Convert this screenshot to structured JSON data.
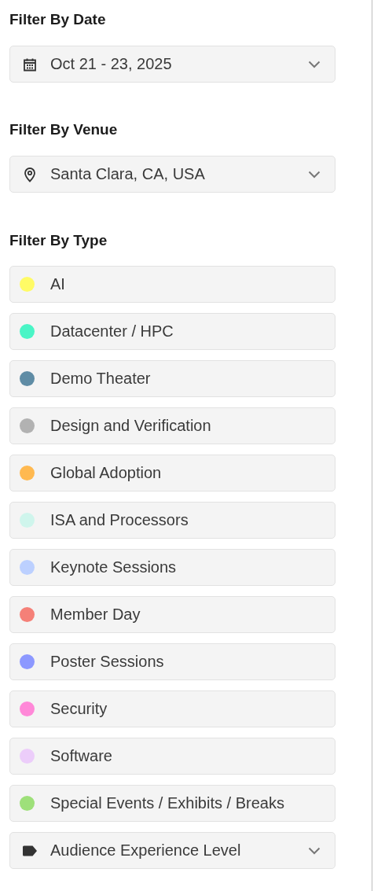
{
  "date_filter": {
    "heading": "Filter By Date",
    "value": "Oct 21 - 23, 2025"
  },
  "venue_filter": {
    "heading": "Filter By Venue",
    "value": "Santa Clara, CA, USA"
  },
  "type_filter": {
    "heading": "Filter By Type",
    "items": [
      {
        "label": "AI",
        "color": "#fffb66"
      },
      {
        "label": "Datacenter / HPC",
        "color": "#4af5c6"
      },
      {
        "label": "Demo Theater",
        "color": "#5f8ca5"
      },
      {
        "label": "Design and Verification",
        "color": "#b2b2b2"
      },
      {
        "label": "Global Adoption",
        "color": "#ffb950"
      },
      {
        "label": "ISA and Processors",
        "color": "#cff5ec"
      },
      {
        "label": "Keynote Sessions",
        "color": "#bcd0ff"
      },
      {
        "label": "Member Day",
        "color": "#f58078"
      },
      {
        "label": "Poster Sessions",
        "color": "#8c98ff"
      },
      {
        "label": "Security",
        "color": "#ff88d8"
      },
      {
        "label": "Software",
        "color": "#eccdfa"
      },
      {
        "label": "Special Events / Exhibits / Breaks",
        "color": "#9ee07a"
      }
    ]
  },
  "audience_filter": {
    "value": "Audience Experience Level"
  }
}
